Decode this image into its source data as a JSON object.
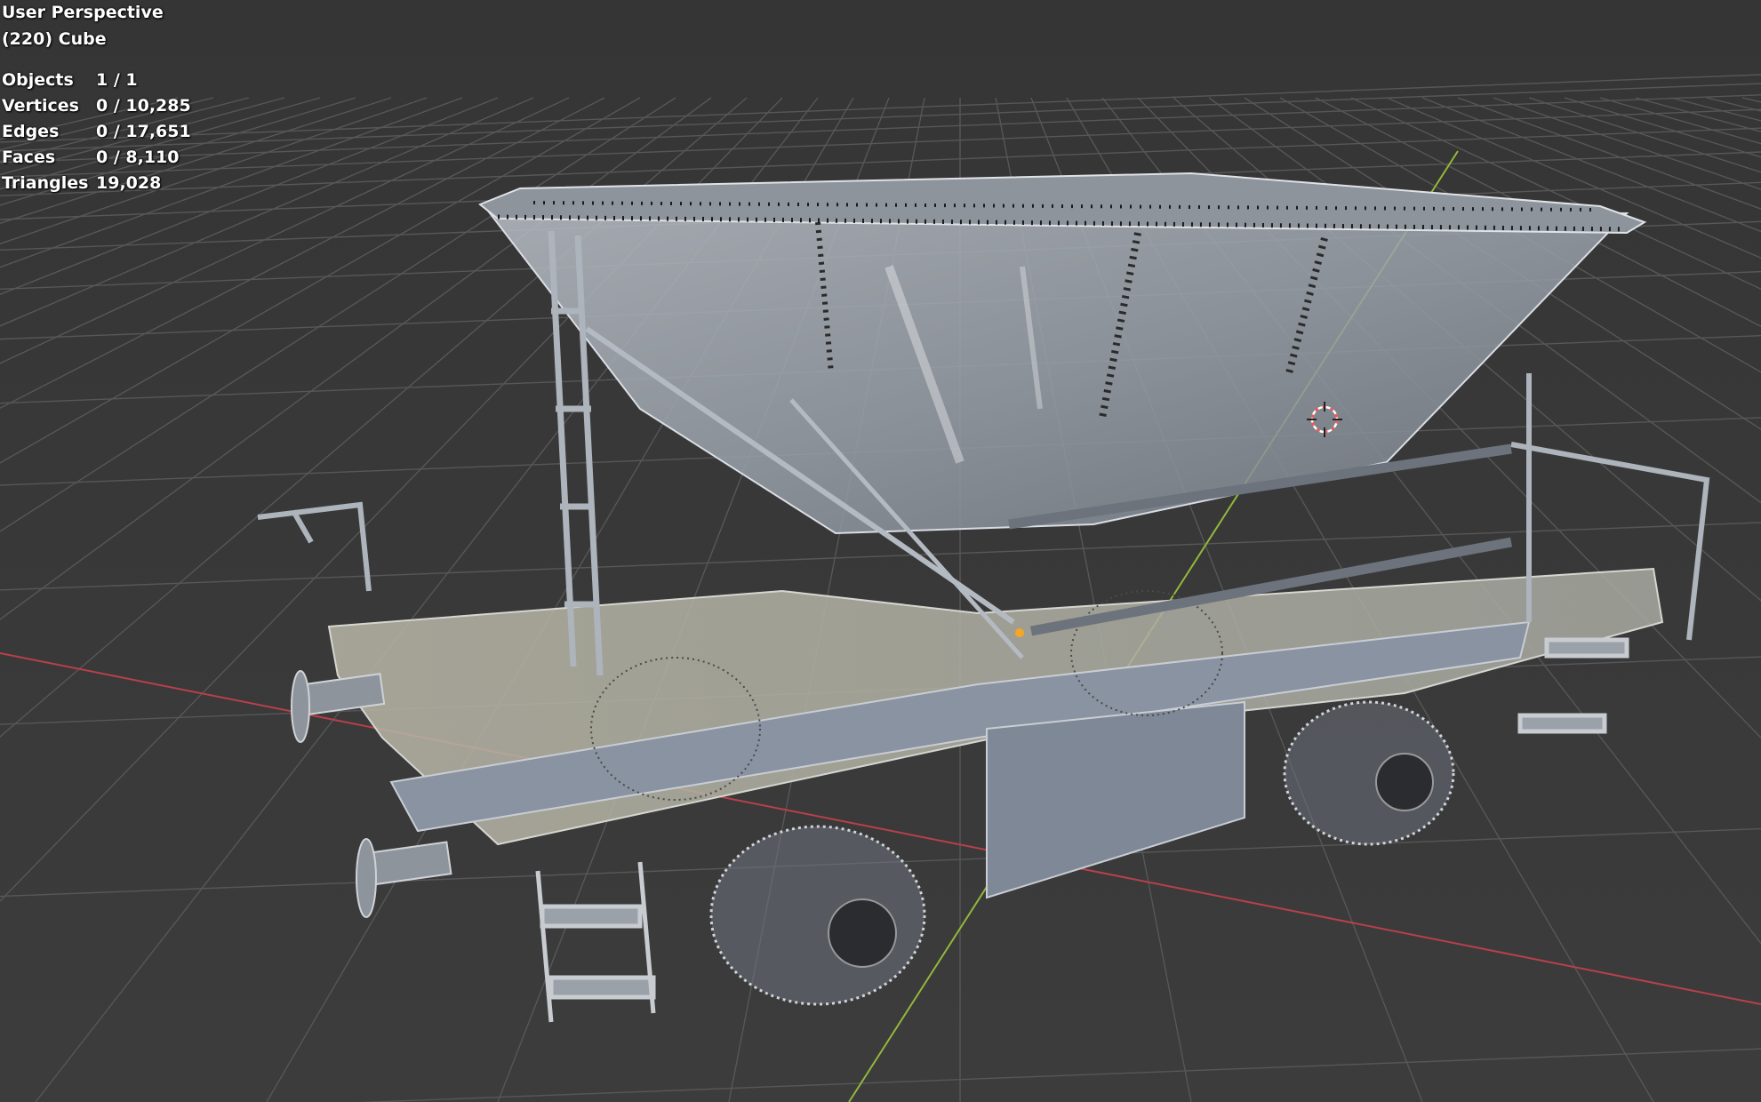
{
  "viewport": {
    "view_name": "User Perspective",
    "active_object": "(220) Cube",
    "background_color": "#3a3a3a",
    "grid_color": "#555555",
    "x_axis_color": "#c0404a",
    "y_axis_color": "#9ac43a"
  },
  "stats": [
    {
      "label": "Objects",
      "value": "1 / 1"
    },
    {
      "label": "Vertices",
      "value": "0 / 10,285"
    },
    {
      "label": "Edges",
      "value": "0 / 17,651"
    },
    {
      "label": "Faces",
      "value": "0 / 8,110"
    },
    {
      "label": "Triangles",
      "value": "19,028"
    }
  ],
  "model": {
    "name": "hopper-wagon-wireframe",
    "icon": "3d-cursor-icon"
  }
}
